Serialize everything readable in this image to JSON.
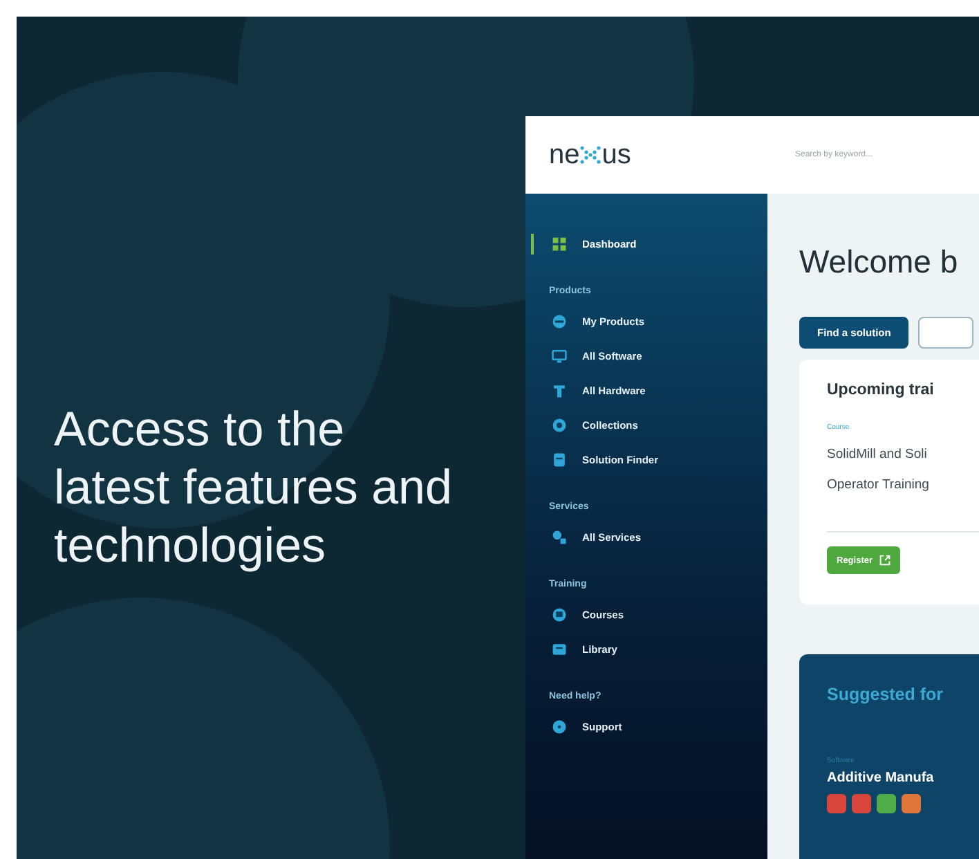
{
  "headline": "Access to the latest features and technologies",
  "app": {
    "logo": {
      "before": "ne",
      "after": "us"
    },
    "search": {
      "placeholder": "Search by keyword..."
    },
    "sidebar": [
      {
        "items": [
          {
            "label": "Dashboard",
            "selected": true
          }
        ]
      },
      {
        "heading": "Products",
        "items": [
          {
            "label": "My Products",
            "selected": false
          },
          {
            "label": "All Software",
            "selected": false
          },
          {
            "label": "All Hardware",
            "selected": false
          },
          {
            "label": "Collections",
            "selected": false
          },
          {
            "label": "Solution Finder",
            "selected": false
          }
        ]
      },
      {
        "heading": "Services",
        "items": [
          {
            "label": "All Services",
            "selected": false
          }
        ]
      },
      {
        "heading": "Training",
        "items": [
          {
            "label": "Courses",
            "selected": false
          },
          {
            "label": "Library",
            "selected": false
          }
        ]
      },
      {
        "heading": "Need help?",
        "items": [
          {
            "label": "Support",
            "selected": false
          }
        ]
      }
    ],
    "main": {
      "title": "Welcome b",
      "buttons": [
        {
          "label": "Find a solution",
          "kind": "primary"
        },
        {
          "kind": "outline"
        }
      ],
      "training": {
        "title": "Upcoming trai",
        "tag": "Course",
        "lines": [
          "SolidMill and Soli",
          "Operator Training"
        ],
        "button": "Register"
      },
      "suggested": {
        "title": "Suggested for",
        "tag": "Software",
        "name": "Additive Manufa",
        "app_icons": [
          {
            "color": "#d8463c"
          },
          {
            "color": "#d8463c"
          },
          {
            "color": "#4fae4a"
          },
          {
            "color": "#e0763a"
          }
        ]
      }
    }
  }
}
